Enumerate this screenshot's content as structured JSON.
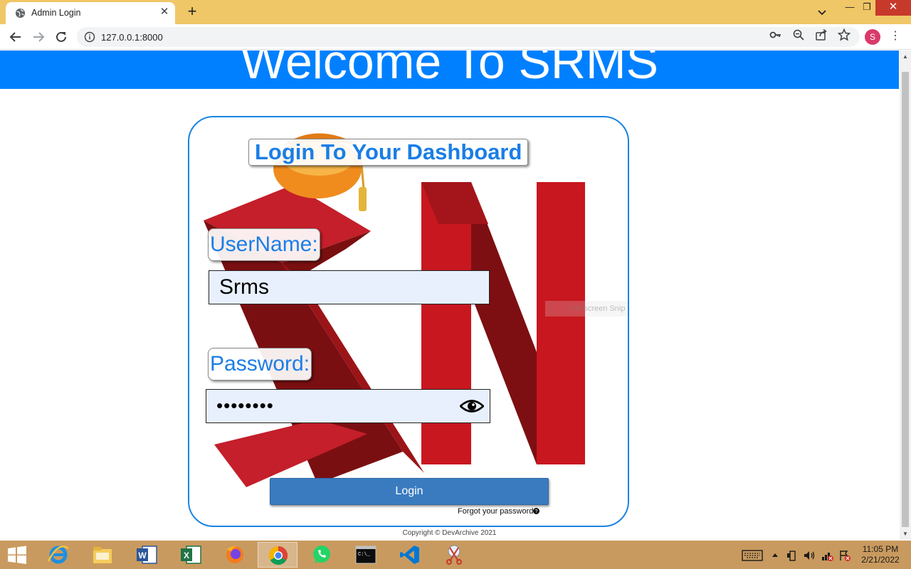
{
  "browser": {
    "tab_title": "Admin Login",
    "tab_close": "✕",
    "new_tab": "+",
    "url": "127.0.0.1:8000",
    "profile_initial": "S",
    "window": {
      "minimize": "—",
      "maximize": "❐",
      "close": "✕"
    }
  },
  "page": {
    "banner_title": "Welcome To SRMS",
    "login_heading": "Login To Your Dashboard",
    "username_label": "UserName:",
    "username_value": "Srms",
    "password_label": "Password:",
    "password_masked": "••••••••",
    "login_button": "Login",
    "forgot_password": "Forgot your password",
    "copyright": "Copyright © DevArchive 2021",
    "overlay_hint": "Full-screen Snip"
  },
  "taskbar": {
    "apps": [
      "internet-explorer",
      "file-explorer",
      "word",
      "excel",
      "firefox",
      "chrome",
      "whatsapp",
      "command-prompt",
      "vscode",
      "snipping-tool"
    ],
    "active_app": "chrome",
    "time": "11:05 PM",
    "date": "2/21/2022"
  },
  "colors": {
    "tabbar": "#f0c766",
    "banner": "#0080ff",
    "accent_text": "#1a7ee6",
    "login_button": "#3a7bbf",
    "taskbar": "#c99a5f"
  }
}
